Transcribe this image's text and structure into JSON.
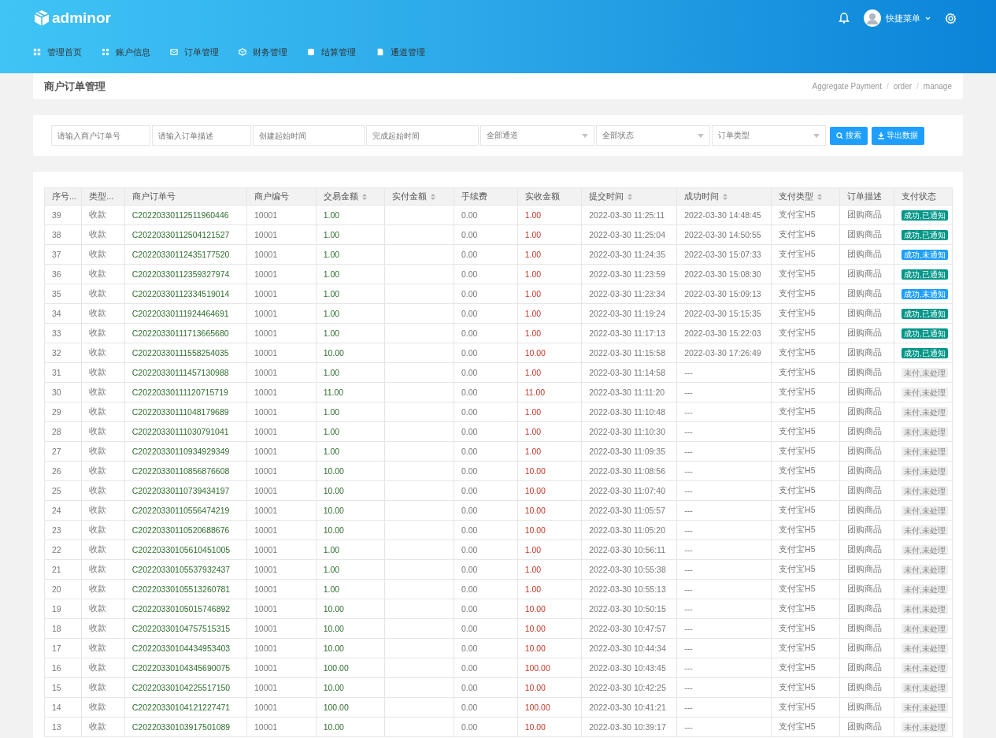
{
  "header": {
    "logo": "adminor",
    "nav": [
      {
        "label": "管理首页"
      },
      {
        "label": "账户信息"
      },
      {
        "label": "订单管理"
      },
      {
        "label": "财务管理"
      },
      {
        "label": "结算管理"
      },
      {
        "label": "通道管理"
      }
    ],
    "user_menu": "快捷菜单"
  },
  "page_title": "商户订单管理",
  "breadcrumb": {
    "separator": "/",
    "items": [
      "Aggregate Payment",
      "order",
      "manage"
    ]
  },
  "filters": [
    {
      "kind": "input",
      "placeholder": "请输入商户订单号"
    },
    {
      "kind": "input",
      "placeholder": "请输入订单描述"
    },
    {
      "kind": "input",
      "placeholder": "创建起始时间"
    },
    {
      "kind": "input",
      "placeholder": "完成起始时间"
    },
    {
      "kind": "select",
      "value": "全部通道"
    },
    {
      "kind": "select",
      "value": "全部状态"
    },
    {
      "kind": "select",
      "value": "订单类型"
    }
  ],
  "buttons": [
    {
      "kind": "search",
      "label": "搜索"
    },
    {
      "kind": "export",
      "label": "导出数据"
    }
  ],
  "table": {
    "columns": [
      {
        "label": "序号...",
        "sortable": false
      },
      {
        "label": "类型...",
        "sortable": false
      },
      {
        "label": "商户订单号",
        "sortable": false
      },
      {
        "label": "商户编号",
        "sortable": false
      },
      {
        "label": "交易金额",
        "sortable": true
      },
      {
        "label": "实付金额",
        "sortable": true
      },
      {
        "label": "手续费",
        "sortable": false
      },
      {
        "label": "实收金额",
        "sortable": false
      },
      {
        "label": "提交时间",
        "sortable": true
      },
      {
        "label": "成功时间",
        "sortable": true
      },
      {
        "label": "支付类型",
        "sortable": true
      },
      {
        "label": "订单描述",
        "sortable": false
      },
      {
        "label": "支付状态",
        "sortable": false
      }
    ],
    "rows": [
      {
        "no": "39",
        "type": "收款",
        "order_no": "C20220330112511960446",
        "merchant": "10001",
        "amount": "1.00",
        "fee": "0.00",
        "received": "1.00",
        "submitted": "2022-03-30 11:25:11",
        "succeeded": "2022-03-30 14:48:45",
        "pay_type": "支付宝H5",
        "desc": "团购商品",
        "status": {
          "label": "成功,已通知",
          "color": "#009688"
        }
      },
      {
        "no": "38",
        "type": "收款",
        "order_no": "C20220330112504121527",
        "merchant": "10001",
        "amount": "1.00",
        "fee": "0.00",
        "received": "1.00",
        "submitted": "2022-03-30 11:25:04",
        "succeeded": "2022-03-30 14:50:55",
        "pay_type": "支付宝H5",
        "desc": "团购商品",
        "status": {
          "label": "成功,已通知",
          "color": "#009688"
        }
      },
      {
        "no": "37",
        "type": "收款",
        "order_no": "C20220330112435177520",
        "merchant": "10001",
        "amount": "1.00",
        "fee": "0.00",
        "received": "1.00",
        "submitted": "2022-03-30 11:24:35",
        "succeeded": "2022-03-30 15:07:33",
        "pay_type": "支付宝H5",
        "desc": "团购商品",
        "status": {
          "label": "成功,未通知",
          "color": "#1e9fff"
        }
      },
      {
        "no": "36",
        "type": "收款",
        "order_no": "C20220330112359327974",
        "merchant": "10001",
        "amount": "1.00",
        "fee": "0.00",
        "received": "1.00",
        "submitted": "2022-03-30 11:23:59",
        "succeeded": "2022-03-30 15:08:30",
        "pay_type": "支付宝H5",
        "desc": "团购商品",
        "status": {
          "label": "成功,已通知",
          "color": "#009688"
        }
      },
      {
        "no": "35",
        "type": "收款",
        "order_no": "C20220330112334519014",
        "merchant": "10001",
        "amount": "1.00",
        "fee": "0.00",
        "received": "1.00",
        "submitted": "2022-03-30 11:23:34",
        "succeeded": "2022-03-30 15:09:13",
        "pay_type": "支付宝H5",
        "desc": "团购商品",
        "status": {
          "label": "成功,未通知",
          "color": "#1e9fff"
        }
      },
      {
        "no": "34",
        "type": "收款",
        "order_no": "C20220330111924464691",
        "merchant": "10001",
        "amount": "1.00",
        "fee": "0.00",
        "received": "1.00",
        "submitted": "2022-03-30 11:19:24",
        "succeeded": "2022-03-30 15:15:35",
        "pay_type": "支付宝H5",
        "desc": "团购商品",
        "status": {
          "label": "成功,已通知",
          "color": "#009688"
        }
      },
      {
        "no": "33",
        "type": "收款",
        "order_no": "C20220330111713665680",
        "merchant": "10001",
        "amount": "1.00",
        "fee": "0.00",
        "received": "1.00",
        "submitted": "2022-03-30 11:17:13",
        "succeeded": "2022-03-30 15:22:03",
        "pay_type": "支付宝H5",
        "desc": "团购商品",
        "status": {
          "label": "成功,已通知",
          "color": "#009688"
        }
      },
      {
        "no": "32",
        "type": "收款",
        "order_no": "C20220330111558254035",
        "merchant": "10001",
        "amount": "10.00",
        "fee": "0.00",
        "received": "10.00",
        "submitted": "2022-03-30 11:15:58",
        "succeeded": "2022-03-30 17:26:49",
        "pay_type": "支付宝H5",
        "desc": "团购商品",
        "status": {
          "label": "成功,已通知",
          "color": "#009688"
        }
      },
      {
        "no": "31",
        "type": "收款",
        "order_no": "C20220330111457130988",
        "merchant": "10001",
        "amount": "1.00",
        "fee": "0.00",
        "received": "1.00",
        "submitted": "2022-03-30 11:14:58",
        "succeeded": "---",
        "pay_type": "支付宝H5",
        "desc": "团购商品",
        "status": {
          "label": "未付,未处理",
          "color": "#eeeeee"
        }
      },
      {
        "no": "30",
        "type": "收款",
        "order_no": "C20220330111120715719",
        "merchant": "10001",
        "amount": "11.00",
        "fee": "0.00",
        "received": "11.00",
        "submitted": "2022-03-30 11:11:20",
        "succeeded": "---",
        "pay_type": "支付宝H5",
        "desc": "团购商品",
        "status": {
          "label": "未付,未处理",
          "color": "#eeeeee"
        }
      },
      {
        "no": "29",
        "type": "收款",
        "order_no": "C20220330111048179689",
        "merchant": "10001",
        "amount": "1.00",
        "fee": "0.00",
        "received": "1.00",
        "submitted": "2022-03-30 11:10:48",
        "succeeded": "---",
        "pay_type": "支付宝H5",
        "desc": "团购商品",
        "status": {
          "label": "未付,未处理",
          "color": "#eeeeee"
        }
      },
      {
        "no": "28",
        "type": "收款",
        "order_no": "C20220330111030791041",
        "merchant": "10001",
        "amount": "1.00",
        "fee": "0.00",
        "received": "1.00",
        "submitted": "2022-03-30 11:10:30",
        "succeeded": "---",
        "pay_type": "支付宝H5",
        "desc": "团购商品",
        "status": {
          "label": "未付,未处理",
          "color": "#eeeeee"
        }
      },
      {
        "no": "27",
        "type": "收款",
        "order_no": "C20220330110934929349",
        "merchant": "10001",
        "amount": "1.00",
        "fee": "0.00",
        "received": "1.00",
        "submitted": "2022-03-30 11:09:35",
        "succeeded": "---",
        "pay_type": "支付宝H5",
        "desc": "团购商品",
        "status": {
          "label": "未付,未处理",
          "color": "#eeeeee"
        }
      },
      {
        "no": "26",
        "type": "收款",
        "order_no": "C20220330110856876608",
        "merchant": "10001",
        "amount": "10.00",
        "fee": "0.00",
        "received": "10.00",
        "submitted": "2022-03-30 11:08:56",
        "succeeded": "---",
        "pay_type": "支付宝H5",
        "desc": "团购商品",
        "status": {
          "label": "未付,未处理",
          "color": "#eeeeee"
        }
      },
      {
        "no": "25",
        "type": "收款",
        "order_no": "C20220330110739434197",
        "merchant": "10001",
        "amount": "10.00",
        "fee": "0.00",
        "received": "10.00",
        "submitted": "2022-03-30 11:07:40",
        "succeeded": "---",
        "pay_type": "支付宝H5",
        "desc": "团购商品",
        "status": {
          "label": "未付,未处理",
          "color": "#eeeeee"
        }
      },
      {
        "no": "24",
        "type": "收款",
        "order_no": "C20220330110556474219",
        "merchant": "10001",
        "amount": "10.00",
        "fee": "0.00",
        "received": "10.00",
        "submitted": "2022-03-30 11:05:57",
        "succeeded": "---",
        "pay_type": "支付宝H5",
        "desc": "团购商品",
        "status": {
          "label": "未付,未处理",
          "color": "#eeeeee"
        }
      },
      {
        "no": "23",
        "type": "收款",
        "order_no": "C20220330110520688676",
        "merchant": "10001",
        "amount": "10.00",
        "fee": "0.00",
        "received": "10.00",
        "submitted": "2022-03-30 11:05:20",
        "succeeded": "---",
        "pay_type": "支付宝H5",
        "desc": "团购商品",
        "status": {
          "label": "未付,未处理",
          "color": "#eeeeee"
        }
      },
      {
        "no": "22",
        "type": "收款",
        "order_no": "C20220330105610451005",
        "merchant": "10001",
        "amount": "1.00",
        "fee": "0.00",
        "received": "1.00",
        "submitted": "2022-03-30 10:56:11",
        "succeeded": "---",
        "pay_type": "支付宝H5",
        "desc": "团购商品",
        "status": {
          "label": "未付,未处理",
          "color": "#eeeeee"
        }
      },
      {
        "no": "21",
        "type": "收款",
        "order_no": "C20220330105537932437",
        "merchant": "10001",
        "amount": "1.00",
        "fee": "0.00",
        "received": "1.00",
        "submitted": "2022-03-30 10:55:38",
        "succeeded": "---",
        "pay_type": "支付宝H5",
        "desc": "团购商品",
        "status": {
          "label": "未付,未处理",
          "color": "#eeeeee"
        }
      },
      {
        "no": "20",
        "type": "收款",
        "order_no": "C20220330105513260781",
        "merchant": "10001",
        "amount": "1.00",
        "fee": "0.00",
        "received": "1.00",
        "submitted": "2022-03-30 10:55:13",
        "succeeded": "---",
        "pay_type": "支付宝H5",
        "desc": "团购商品",
        "status": {
          "label": "未付,未处理",
          "color": "#eeeeee"
        }
      },
      {
        "no": "19",
        "type": "收款",
        "order_no": "C20220330105015746892",
        "merchant": "10001",
        "amount": "10.00",
        "fee": "0.00",
        "received": "10.00",
        "submitted": "2022-03-30 10:50:15",
        "succeeded": "---",
        "pay_type": "支付宝H5",
        "desc": "团购商品",
        "status": {
          "label": "未付,未处理",
          "color": "#eeeeee"
        }
      },
      {
        "no": "18",
        "type": "收款",
        "order_no": "C20220330104757515315",
        "merchant": "10001",
        "amount": "10.00",
        "fee": "0.00",
        "received": "10.00",
        "submitted": "2022-03-30 10:47:57",
        "succeeded": "---",
        "pay_type": "支付宝H5",
        "desc": "团购商品",
        "status": {
          "label": "未付,未处理",
          "color": "#eeeeee"
        }
      },
      {
        "no": "17",
        "type": "收款",
        "order_no": "C20220330104434953403",
        "merchant": "10001",
        "amount": "10.00",
        "fee": "0.00",
        "received": "10.00",
        "submitted": "2022-03-30 10:44:34",
        "succeeded": "---",
        "pay_type": "支付宝H5",
        "desc": "团购商品",
        "status": {
          "label": "未付,未处理",
          "color": "#eeeeee"
        }
      },
      {
        "no": "16",
        "type": "收款",
        "order_no": "C20220330104345690075",
        "merchant": "10001",
        "amount": "100.00",
        "fee": "0.00",
        "received": "100.00",
        "submitted": "2022-03-30 10:43:45",
        "succeeded": "---",
        "pay_type": "支付宝H5",
        "desc": "团购商品",
        "status": {
          "label": "未付,未处理",
          "color": "#eeeeee"
        }
      },
      {
        "no": "15",
        "type": "收款",
        "order_no": "C20220330104225517150",
        "merchant": "10001",
        "amount": "10.00",
        "fee": "0.00",
        "received": "10.00",
        "submitted": "2022-03-30 10:42:25",
        "succeeded": "---",
        "pay_type": "支付宝H5",
        "desc": "团购商品",
        "status": {
          "label": "未付,未处理",
          "color": "#eeeeee"
        }
      },
      {
        "no": "14",
        "type": "收款",
        "order_no": "C20220330104121227471",
        "merchant": "10001",
        "amount": "100.00",
        "fee": "0.00",
        "received": "100.00",
        "submitted": "2022-03-30 10:41:21",
        "succeeded": "---",
        "pay_type": "支付宝H5",
        "desc": "团购商品",
        "status": {
          "label": "未付,未处理",
          "color": "#eeeeee"
        }
      },
      {
        "no": "13",
        "type": "收款",
        "order_no": "C20220330103917501089",
        "merchant": "10001",
        "amount": "10.00",
        "fee": "0.00",
        "received": "10.00",
        "submitted": "2022-03-30 10:39:17",
        "succeeded": "---",
        "pay_type": "支付宝H5",
        "desc": "团购商品",
        "status": {
          "label": "未付,未处理",
          "color": "#eeeeee"
        }
      }
    ]
  }
}
